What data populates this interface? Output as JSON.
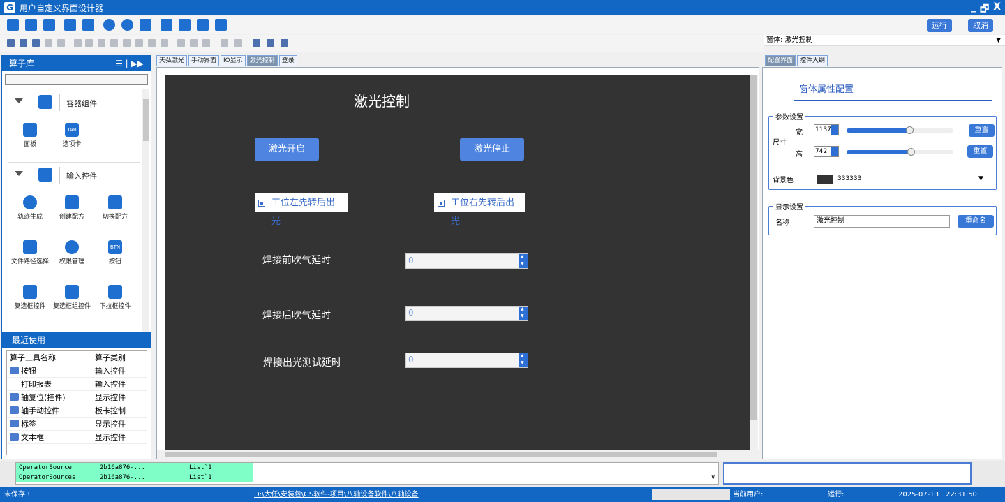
{
  "window": {
    "title": "用户自定义界面设计器",
    "controls": [
      "_",
      "🗗",
      "X"
    ]
  },
  "toolbar": {
    "run": "运行",
    "cancel": "取消"
  },
  "form_selector": {
    "label": "窗体:",
    "value": "激光控制"
  },
  "left_panel": {
    "title": "算子库",
    "sections": [
      {
        "label": "容器组件",
        "tools": [
          "面板",
          "选项卡"
        ]
      },
      {
        "label": "输入控件",
        "tools": [
          "轨迹生成",
          "创建配方",
          "切换配方",
          "文件路径选择",
          "权限管理",
          "按钮",
          "复选框控件",
          "复选框组控件",
          "下拉框控件"
        ]
      }
    ],
    "tab_icon_text": "TAB",
    "btn_icon_text": "BTN",
    "recent": {
      "title": "最近使用",
      "columns": [
        "算子工具名称",
        "算子类别"
      ],
      "rows": [
        {
          "name": "按钮",
          "category": "输入控件"
        },
        {
          "name": "打印报表",
          "category": "输入控件"
        },
        {
          "name": "轴复位(控件)",
          "category": "显示控件"
        },
        {
          "name": "轴手动控件",
          "category": "板卡控制"
        },
        {
          "name": "标签",
          "category": "显示控件"
        },
        {
          "name": "文本框",
          "category": "显示控件"
        }
      ]
    }
  },
  "doc_tabs": [
    "天弘激光",
    "手动界面",
    "IO显示",
    "激光控制",
    "登录"
  ],
  "canvas": {
    "title": "激光控制",
    "btn_on": "激光开启",
    "btn_off": "激光停止",
    "check_left": "工位左先转后出光",
    "check_right": "工位右先转后出光",
    "label1": "焊接前吹气延时",
    "label2": "焊接后吹气延时",
    "label3": "焊接出光测试延时",
    "value1": "0",
    "value2": "0",
    "value3": "0",
    "background": "#333333"
  },
  "right_panel": {
    "tabs": [
      "配置界面",
      "控件大纲"
    ],
    "title": "窗体属性配置",
    "params_group": "参数设置",
    "size_label": "尺寸",
    "width_label": "宽",
    "width_value": "1137",
    "width_fraction": 0.59,
    "height_label": "高",
    "height_value": "742",
    "height_fraction": 0.6,
    "reset": "重置",
    "bg_label": "背景色",
    "bg_value": "333333",
    "display_group": "显示设置",
    "name_label": "名称",
    "name_value": "激光控制",
    "rename": "重命名"
  },
  "output": {
    "rows": [
      {
        "name": "OperatorSource",
        "id": "2b16a876-...",
        "type": "List`1"
      },
      {
        "name": "OperatorSources",
        "id": "2b16a876-...",
        "type": "List`1"
      }
    ]
  },
  "status": {
    "saved": "未保存 !",
    "path": "D:\\大任\\安装包\\GS软件-项目\\八轴设备软件\\八轴设备",
    "user_label": "当前用户:",
    "run_label": "运行:",
    "date": "2025-07-13",
    "time": "22:31:50"
  }
}
